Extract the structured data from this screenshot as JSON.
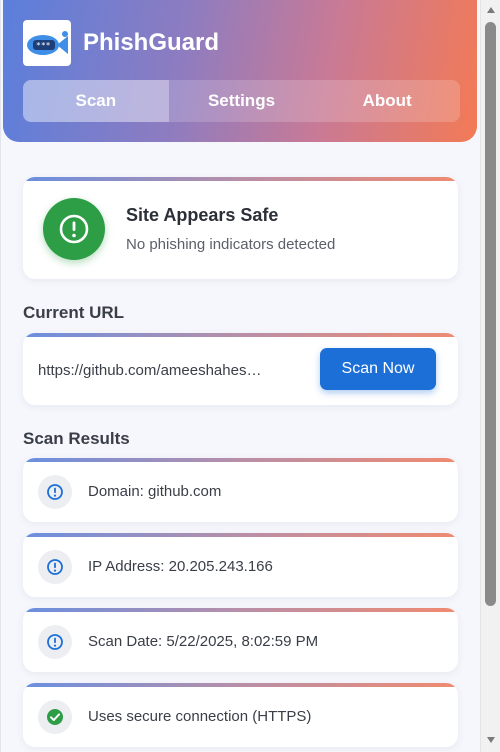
{
  "app": {
    "title": "PhishGuard",
    "logo": "phishguard-logo"
  },
  "tabs": [
    {
      "label": "Scan",
      "active": true
    },
    {
      "label": "Settings",
      "active": false
    },
    {
      "label": "About",
      "active": false
    }
  ],
  "status": {
    "title": "Site Appears Safe",
    "subtitle": "No phishing indicators detected",
    "icon": "alert-circle-icon",
    "color": "#2e9e46"
  },
  "current_url": {
    "heading": "Current URL",
    "url": "https://github.com/ameeshahes…",
    "button_label": "Scan Now"
  },
  "results": {
    "heading": "Scan Results",
    "items": [
      {
        "text": "Domain: github.com",
        "icon": "info-icon",
        "icon_color": "#1d6fd8"
      },
      {
        "text": "IP Address: 20.205.243.166",
        "icon": "info-icon",
        "icon_color": "#1d6fd8"
      },
      {
        "text": "Scan Date: 5/22/2025, 8:02:59 PM",
        "icon": "info-icon",
        "icon_color": "#1d6fd8"
      },
      {
        "text": "Uses secure connection (HTTPS)",
        "icon": "check-icon",
        "icon_color": "#2e9e46"
      }
    ]
  },
  "colors": {
    "accent": "#1d6fd8",
    "safe": "#2e9e46",
    "header_gradient_start": "#5a7fdc",
    "header_gradient_end": "#f37a55"
  }
}
